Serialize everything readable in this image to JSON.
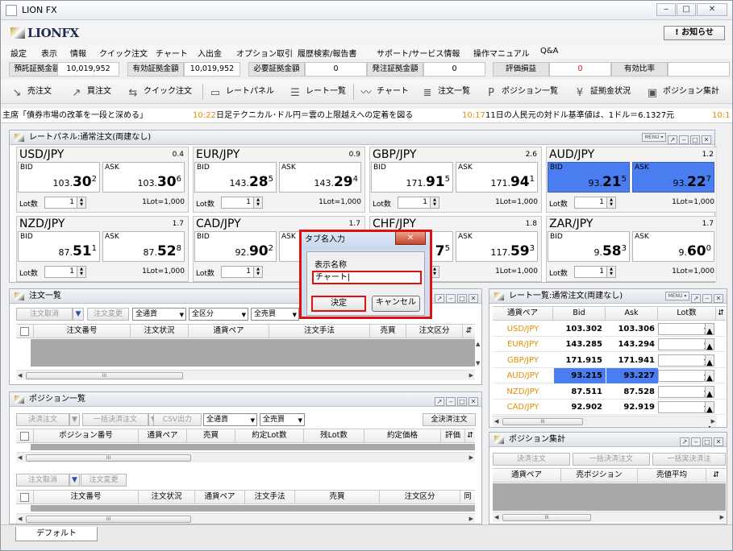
{
  "window": {
    "title": "LION FX",
    "min": "‒",
    "max": "□",
    "close": "✕"
  },
  "brand": {
    "logo": "LIONFX",
    "notice_button": "! お知らせ"
  },
  "menu": [
    "設定",
    "表示",
    "情報",
    "クイック注文",
    "チャート",
    "入出金",
    "オプション取引",
    "履歴検索/報告書",
    "サポート/サービス情報",
    "操作マニュアル",
    "Q&A"
  ],
  "summary": [
    {
      "label": "預託証拠金額",
      "value": "10,019,952"
    },
    {
      "label": "有効証拠金額",
      "value": "10,019,952"
    },
    {
      "label": "必要証拠金額",
      "value": "0"
    },
    {
      "label": "発注証拠金額",
      "value": "0"
    },
    {
      "label": "評価損益",
      "value": "0"
    },
    {
      "label": "有効比率",
      "value": ""
    }
  ],
  "toolbar": [
    {
      "label": "売注文",
      "icon": "sell-arrow-icon"
    },
    {
      "label": "買注文",
      "icon": "buy-arrow-icon"
    },
    {
      "label": "クイック注文",
      "icon": "quick-order-icon"
    },
    {
      "label": "レートパネル",
      "icon": "rate-panel-icon"
    },
    {
      "label": "レート一覧",
      "icon": "rate-list-icon"
    },
    {
      "label": "チャート",
      "icon": "chart-icon"
    },
    {
      "label": "注文一覧",
      "icon": "order-list-icon"
    },
    {
      "label": "ポジション一覧",
      "icon": "position-list-icon"
    },
    {
      "label": "証拠金状況",
      "icon": "yen-icon"
    },
    {
      "label": "ポジション集計",
      "icon": "position-summary-icon"
    }
  ],
  "ticker": [
    {
      "time": "",
      "text": "主席「債券市場の改革を一段と深める」"
    },
    {
      "time": "10:22",
      "text": "日足テクニカル･ドル円＝雲の上限越えへの定着を図る"
    },
    {
      "time": "10:17",
      "text": "11日の人民元の対ドル基準値は、1ドル＝6.1327元"
    },
    {
      "time": "10:1",
      "text": ""
    }
  ],
  "rate_panel": {
    "title": "レートパネル:通常注文(両建なし)",
    "menu_label": "MENU ▾",
    "bid_label": "BID",
    "ask_label": "ASK",
    "lot_label": "Lot数",
    "lot_info": "1Lot=1,000",
    "cards": [
      {
        "pair": "USD/JPY",
        "spread": "0.4",
        "bid": [
          "103.",
          "30",
          "2"
        ],
        "ask": [
          "103.",
          "30",
          "6"
        ],
        "lot": "1",
        "hl": false
      },
      {
        "pair": "EUR/JPY",
        "spread": "0.9",
        "bid": [
          "143.",
          "28",
          "5"
        ],
        "ask": [
          "143.",
          "29",
          "4"
        ],
        "lot": "1",
        "hl": false
      },
      {
        "pair": "GBP/JPY",
        "spread": "2.6",
        "bid": [
          "171.",
          "91",
          "5"
        ],
        "ask": [
          "171.",
          "94",
          "1"
        ],
        "lot": "1",
        "hl": false
      },
      {
        "pair": "AUD/JPY",
        "spread": "1.2",
        "bid": [
          "93.",
          "21",
          "5"
        ],
        "ask": [
          "93.",
          "22",
          "7"
        ],
        "lot": "1",
        "hl": true
      },
      {
        "pair": "NZD/JPY",
        "spread": "1.7",
        "bid": [
          "87.",
          "51",
          "1"
        ],
        "ask": [
          "87.",
          "52",
          "8"
        ],
        "lot": "1",
        "hl": false
      },
      {
        "pair": "CAD/JPY",
        "spread": "1.7",
        "bid": [
          "92.",
          "90",
          "2"
        ],
        "ask": [
          "",
          "",
          ""
        ],
        "lot": "1",
        "hl": false
      },
      {
        "pair": "CHF/JPY",
        "spread": "1.8",
        "bid": [
          "",
          "7",
          "5"
        ],
        "ask": [
          "117.",
          "59",
          "3"
        ],
        "lot": "1",
        "hl": false
      },
      {
        "pair": "ZAR/JPY",
        "spread": "1.7",
        "bid": [
          "9.",
          "58",
          "3"
        ],
        "ask": [
          "9.",
          "60",
          "0"
        ],
        "lot": "1",
        "hl": false
      }
    ]
  },
  "order_list": {
    "title": "注文一覧",
    "btn_cancel": "注文取消",
    "btn_change": "注文変更",
    "filters": [
      "全通貨",
      "全区分",
      "全売買"
    ],
    "columns": [
      "注文番号",
      "注文状況",
      "通貨ペア",
      "注文手法",
      "売買",
      "注文区分"
    ]
  },
  "position_list": {
    "title": "ポジション一覧",
    "btn_settle": "決済注文",
    "btn_bulk": "一括決済注文",
    "btn_csv": "CSV出力",
    "filters": [
      "全通貨",
      "全売買"
    ],
    "btn_all": "全決済注文",
    "columns": [
      "ポジション番号",
      "通貨ペア",
      "売買",
      "約定Lot数",
      "残Lot数",
      "約定価格",
      "評価"
    ],
    "sub_btn_cancel": "注文取消",
    "sub_btn_change": "注文変更",
    "sub_columns": [
      "注文番号",
      "注文状況",
      "通貨ペア",
      "注文手法",
      "売買",
      "注文区分",
      "同"
    ]
  },
  "rate_list": {
    "title": "レート一覧:通常注文(両建なし)",
    "columns": [
      "通貨ペア",
      "Bid",
      "Ask",
      "Lot数"
    ],
    "rows": [
      {
        "pair": "USD/JPY",
        "bid": "103.302",
        "ask": "103.306",
        "lot": "1",
        "hl": false
      },
      {
        "pair": "EUR/JPY",
        "bid": "143.285",
        "ask": "143.294",
        "lot": "1",
        "hl": false
      },
      {
        "pair": "GBP/JPY",
        "bid": "171.915",
        "ask": "171.941",
        "lot": "1",
        "hl": false
      },
      {
        "pair": "AUD/JPY",
        "bid": "93.215",
        "ask": "93.227",
        "lot": "1",
        "hl": true
      },
      {
        "pair": "NZD/JPY",
        "bid": "87.511",
        "ask": "87.528",
        "lot": "1",
        "hl": false
      },
      {
        "pair": "CAD/JPY",
        "bid": "92.902",
        "ask": "92.919",
        "lot": "1",
        "hl": false
      }
    ]
  },
  "position_summary": {
    "title": "ポジション集計",
    "btn_settle": "決済注文",
    "btn_bulk": "一括決済注文",
    "btn_bulk2": "一括実決済注",
    "columns": [
      "通貨ペア",
      "売ポジション",
      "売値平均"
    ]
  },
  "status": {
    "tab": "デフォルト"
  },
  "dialog": {
    "title": "タブ名入力",
    "close": "✕",
    "label": "表示名称",
    "value": "チャート|",
    "ok": "決定",
    "cancel": "キャンセル"
  },
  "scroll_mark": "III"
}
